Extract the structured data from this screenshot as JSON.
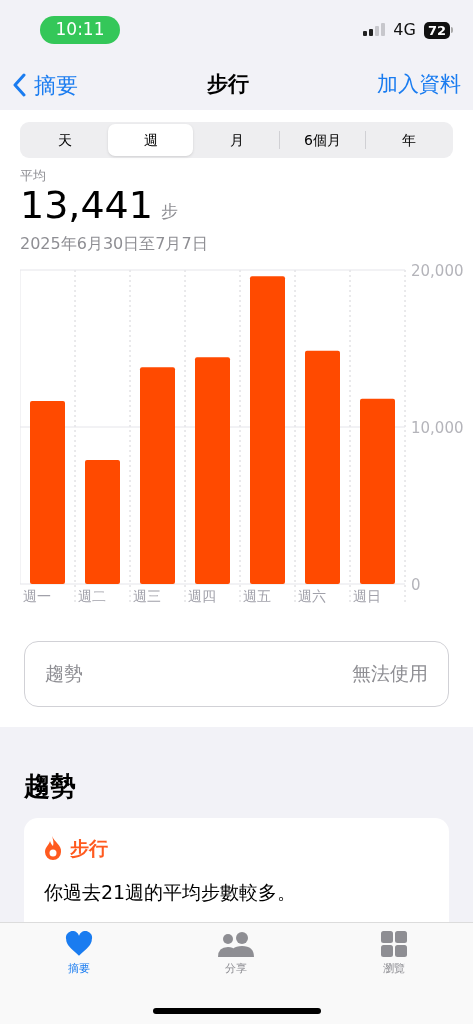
{
  "status_bar": {
    "time": "10:11",
    "network": "4G",
    "battery": "72"
  },
  "nav": {
    "back": "摘要",
    "title": "步行",
    "action": "加入資料"
  },
  "segments": [
    {
      "label": "天",
      "selected": false
    },
    {
      "label": "週",
      "selected": true
    },
    {
      "label": "月",
      "selected": false
    },
    {
      "label": "6個月",
      "selected": false
    },
    {
      "label": "年",
      "selected": false
    }
  ],
  "summary": {
    "label": "平均",
    "value": "13,441",
    "unit": "步",
    "range": "2025年6月30日至7月7日"
  },
  "chart_data": {
    "type": "bar",
    "categories": [
      "週一",
      "週二",
      "週三",
      "週四",
      "週五",
      "週六",
      "週日"
    ],
    "series": [
      {
        "color": "#ff4a00",
        "values": [
          11650,
          7900,
          13800,
          14450,
          19600,
          14850,
          11800
        ]
      }
    ],
    "ylim": [
      0,
      20000
    ],
    "yticks": [
      {
        "value": 0,
        "label": "0"
      },
      {
        "value": 10000,
        "label": "10,000"
      },
      {
        "value": 20000,
        "label": "20,000"
      }
    ]
  },
  "trend_row": {
    "label": "趨勢",
    "value": "無法使用"
  },
  "trends": {
    "heading": "趨勢",
    "card": {
      "title": "步行",
      "text": "你過去21週的平均步數較多。"
    }
  },
  "tab_bar": [
    {
      "label": "摘要",
      "kind": "heart",
      "selected": true
    },
    {
      "label": "分享",
      "kind": "people",
      "selected": false
    },
    {
      "label": "瀏覽",
      "kind": "grid",
      "selected": false
    }
  ]
}
